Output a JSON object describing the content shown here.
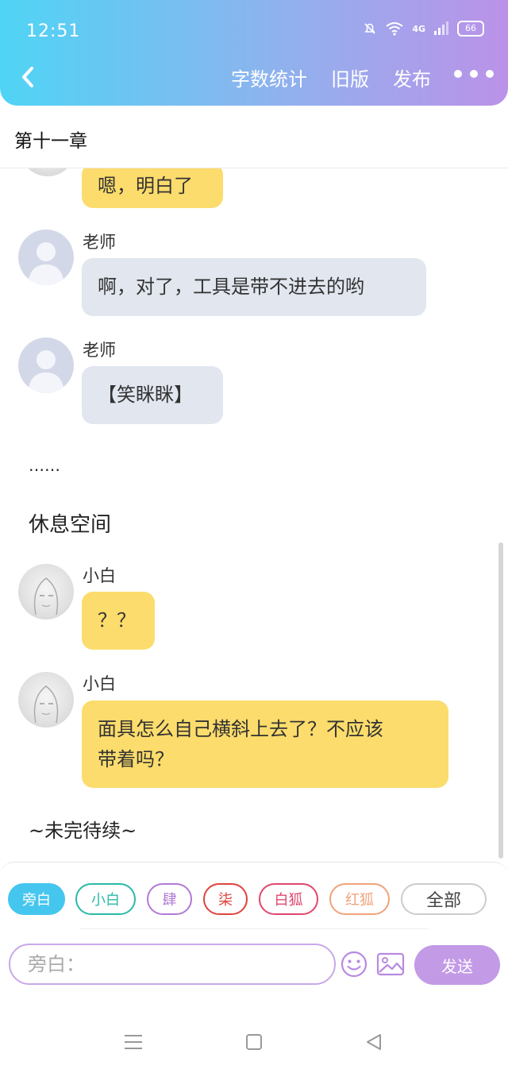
{
  "status_bar": {
    "time": "12:51",
    "network": "4G",
    "battery": "66"
  },
  "header": {
    "word_count": "字数统计",
    "old_version": "旧版",
    "publish": "发布"
  },
  "chapter": {
    "title": "第十一章"
  },
  "messages": [
    {
      "speaker": "小白",
      "name": "",
      "text": "嗯，明白了",
      "style": "yellow"
    },
    {
      "speaker": "老师",
      "name": "老师",
      "text": "啊，对了，工具是带不进去的哟",
      "style": "gray"
    },
    {
      "speaker": "老师",
      "name": "老师",
      "text": "【笑眯眯】",
      "style": "gray"
    },
    {
      "speaker": "旁白",
      "text": "……"
    },
    {
      "speaker": "旁白",
      "text": "休息空间"
    },
    {
      "speaker": "小白",
      "name": "小白",
      "text": "？？",
      "style": "yellow"
    },
    {
      "speaker": "小白",
      "name": "小白",
      "text_line1": "面具怎么自己横斜上去了？不应该",
      "text_line2": "带着吗？",
      "style": "yellow"
    },
    {
      "speaker": "旁白",
      "text": "~未完待续~"
    }
  ],
  "characters": [
    {
      "label": "旁白",
      "color": "#45c6ef",
      "selected": true
    },
    {
      "label": "小白",
      "color": "#2bb9a8",
      "selected": false
    },
    {
      "label": "肆",
      "color": "#b07ad6",
      "selected": false
    },
    {
      "label": "柒",
      "color": "#e0433e",
      "selected": false
    },
    {
      "label": "白狐",
      "color": "#e0476e",
      "selected": false
    },
    {
      "label": "红狐",
      "color": "#f0a37a",
      "selected": false
    },
    {
      "label": "全部",
      "color": "#cccccc",
      "selected": false
    }
  ],
  "composer": {
    "placeholder": "旁白：",
    "emoji_icon": "smiley-icon",
    "image_icon": "image-icon",
    "send": "发送"
  }
}
